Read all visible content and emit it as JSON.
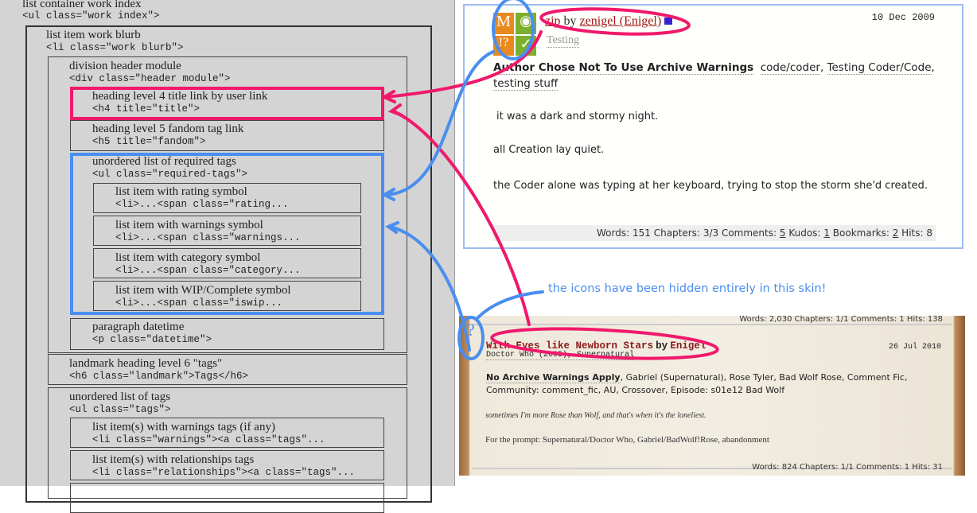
{
  "left": {
    "container": {
      "label": "list container work index",
      "code": "<ul class=\"work index\">"
    },
    "blurb": {
      "label": "list item work blurb",
      "code": "<li class=\"work blurb\">"
    },
    "header": {
      "label": "division header module",
      "code": "<div class=\"header module\">"
    },
    "h4": {
      "label": "heading level 4 title link by user link",
      "code": "<h4 title=\"title\">"
    },
    "h5": {
      "label": "heading level 5 fandom tag link",
      "code": "<h5 title=\"fandom\">"
    },
    "required": {
      "label": "unordered list of required tags",
      "code": "<ul class=\"required-tags\">"
    },
    "req_items": [
      {
        "label": "list item with rating symbol",
        "code": "<li>...<span class=\"rating..."
      },
      {
        "label": "list item with warnings symbol",
        "code": "<li>...<span class=\"warnings..."
      },
      {
        "label": "list item with category symbol",
        "code": "<li>...<span class=\"category..."
      },
      {
        "label": "list item with WIP/Complete symbol",
        "code": "<li>...<span class=\"iswip..."
      }
    ],
    "datetime": {
      "label": "paragraph datetime",
      "code": "<p class=\"datetime\">"
    },
    "landmark": {
      "label": "landmark heading level 6 \"tags\"",
      "code": "<h6 class=\"landmark\">Tags</h6>"
    },
    "tags": {
      "label": "unordered list of tags",
      "code": "<ul class=\"tags\">"
    },
    "tag_items": [
      {
        "label": "list item(s) with warnings tags (if any)",
        "code": "<li class=\"warnings\"><a class=\"tags\"..."
      },
      {
        "label": "list item(s) with relationships tags",
        "code": "<li class=\"relationships\"><a class=\"tags\"..."
      }
    ]
  },
  "card": {
    "icons": [
      "M",
      "◉",
      "!?",
      "✓"
    ],
    "title": "zip",
    "by": "by",
    "author": "zenigel (Enigel)",
    "date": "10 Dec 2009",
    "fandom": "Testing",
    "warning": "Author Chose Not To Use Archive Warnings",
    "tags": [
      "code/coder",
      "Testing Coder/Code",
      "testing stuff"
    ],
    "paras": [
      "it was a dark and stormy night.",
      "all Creation lay quiet.",
      "the Coder alone was typing at her keyboard, trying to stop the storm she'd created."
    ],
    "stats": {
      "words_label": "Words:",
      "words": "151",
      "chapters_label": "Chapters:",
      "chapters": "3/3",
      "comments_label": "Comments:",
      "comments": "5",
      "kudos_label": "Kudos:",
      "kudos": "1",
      "bookmarks_label": "Bookmarks:",
      "bookmarks": "2",
      "hits_label": "Hits:",
      "hits": "8"
    }
  },
  "note": "the icons have been hidden entirely in this skin!",
  "skin": {
    "top_stats": "Words: 2,030 Chapters: 1/1 Comments: 1 Hits: 138",
    "question": "?",
    "title": "With Eyes like Newborn Stars",
    "by": "by",
    "author": "Enigel",
    "date": "26 Jul 2010",
    "fandoms": "Doctor Who (2005), Supernatural",
    "warning": "No Archive Warnings Apply",
    "tags": "Gabriel (Supernatural), Rose Tyler, Bad Wolf Rose, Comment Fic, Community: comment_fic, AU, Crossover, Episode: s01e12 Bad Wolf",
    "summary": "sometimes I'm more Rose than Wolf, and that's when it's the loneliest.",
    "prompt": "For the prompt: Supernatural/Doctor Who, Gabriel/BadWolf!Rose, abandonment",
    "bottom_stats": "Words: 824 Chapters: 1/1 Comments: 1 Hits: 31"
  },
  "colors": {
    "pink": "#f0196b",
    "blue": "#4a8ef0"
  }
}
